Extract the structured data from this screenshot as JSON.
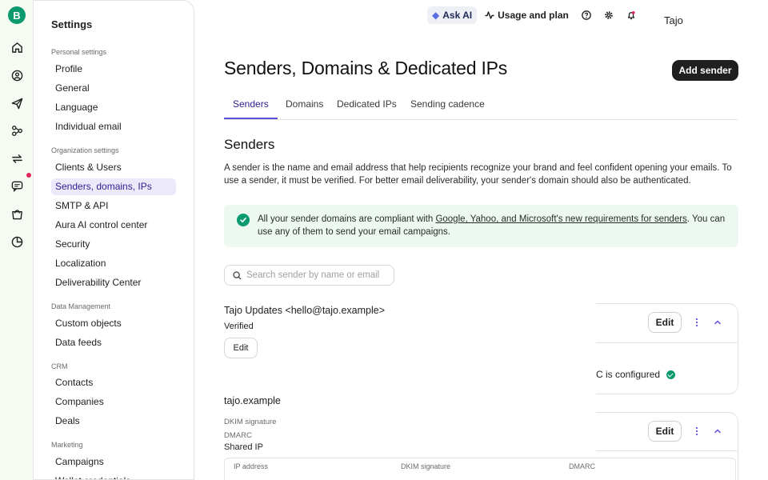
{
  "rail": {
    "logo": "B",
    "icons": [
      "home-icon",
      "contacts-icon",
      "campaigns-icon",
      "automations-icon",
      "transactional-icon",
      "conversations-icon",
      "sales-icon",
      "analytics-icon"
    ]
  },
  "settings_panel": {
    "title": "Settings",
    "sections": [
      {
        "label": "Personal settings",
        "items": [
          "Profile",
          "General",
          "Language",
          "Individual email"
        ]
      },
      {
        "label": "Organization settings",
        "items": [
          "Clients & Users",
          "Senders, domains, IPs",
          "SMTP & API",
          "Aura AI control center",
          "Security",
          "Localization",
          "Deliverability Center"
        ]
      },
      {
        "label": "Data Management",
        "items": [
          "Custom objects",
          "Data feeds"
        ]
      },
      {
        "label": "CRM",
        "items": [
          "Contacts",
          "Companies",
          "Deals"
        ]
      },
      {
        "label": "Marketing",
        "items": [
          "Campaigns",
          "Wallet credentials"
        ]
      }
    ],
    "active_item": "Senders, domains, IPs"
  },
  "topbar": {
    "ask_ai": "Ask AI",
    "usage": "Usage and plan",
    "user": "Tajo"
  },
  "page": {
    "title": "Senders, Domains & Dedicated IPs",
    "add_sender": "Add sender",
    "tabs": [
      "Senders",
      "Domains",
      "Dedicated IPs",
      "Sending cadence"
    ],
    "active_tab": "Senders",
    "section_title": "Senders",
    "description": "A sender is the name and email address that help recipients recognize your brand and feel confident opening your emails. To use a sender, it must be verified. For better email deliverability, your sender's domain should also be authenticated.",
    "notice_prefix": "All your sender domains are compliant with ",
    "notice_link": "Google, Yahoo, and Microsoft's new requirements for senders",
    "notice_suffix": ". You can use any of them to send your email campaigns.",
    "search_placeholder": "Search sender by name or email"
  },
  "sender": {
    "name": "Tajo Updates <hello@tajo.example>",
    "status": "Verified",
    "edit": "Edit",
    "card_edit": "Edit",
    "configured_text": "C is configured"
  },
  "domain": {
    "name": "tajo.example",
    "dkim_label": "DKIM signature",
    "dmarc_label": "DMARC",
    "shared_ip": "Shared IP",
    "card_edit": "Edit",
    "table_headers": [
      "IP address",
      "DKIM signature",
      "DMARC"
    ]
  },
  "colors": {
    "accent": "#5b4fd6",
    "success": "#0b996e",
    "rail_bg": "#f5fbf3",
    "notice_bg": "#edf8f0"
  }
}
